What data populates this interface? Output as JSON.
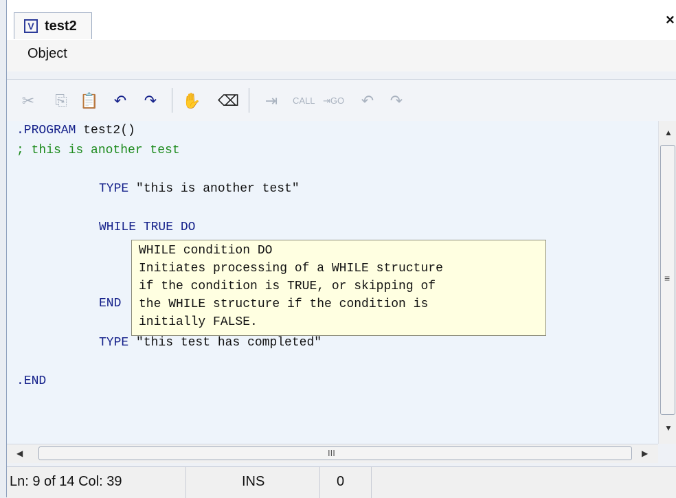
{
  "tab": {
    "label": "test2",
    "icon": "vplus-file-icon"
  },
  "window": {
    "close_label": "×"
  },
  "menu": {
    "items": [
      "Object"
    ]
  },
  "toolbar": {
    "icons": [
      "cut-icon",
      "copy-icon",
      "paste-icon",
      "undo-icon",
      "redo-icon",
      "hand-icon",
      "eraser-icon",
      "step-icon",
      "call-icon",
      "go-icon",
      "undo-disabled-icon",
      "redo-disabled-icon"
    ]
  },
  "editor": {
    "lines": [
      {
        "kw": ".PROGRAM",
        "tx": " test2()"
      },
      {
        "cm": "; this is another test"
      },
      {
        "kw": "TYPE",
        "tx": " \"this is another test\""
      },
      {
        "kw": "WHILE TRUE DO"
      },
      {
        "kw": "END"
      },
      {
        "kw": "TYPE",
        "tx": " \"this test has completed\""
      },
      {
        "kw": ".END"
      }
    ]
  },
  "tooltip": {
    "lines": [
      "WHILE condition DO",
      "Initiates processing of a WHILE structure",
      "if the condition is TRUE, or skipping of",
      "the WHILE structure if the condition is",
      "initially FALSE."
    ]
  },
  "scroll": {
    "h_grip": "III",
    "v_grip": "≡"
  },
  "status": {
    "position": "Ln: 9 of 14  Col: 39",
    "mode": "INS",
    "count": "0"
  }
}
